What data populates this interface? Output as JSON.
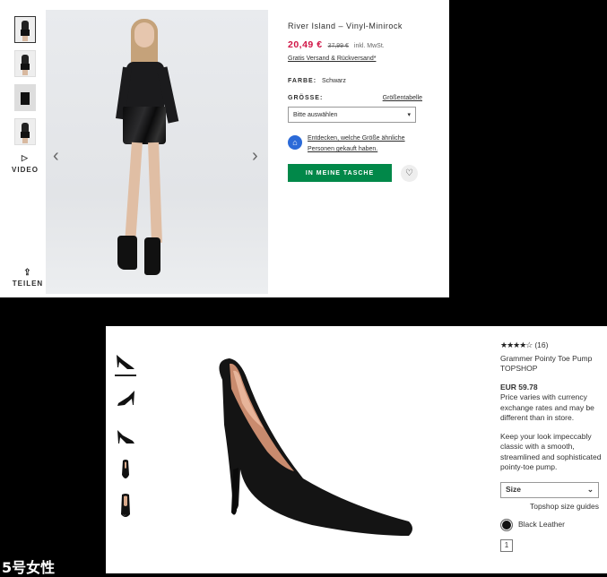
{
  "asos": {
    "video_label": "VIDEO",
    "share_label": "TEILEN",
    "product_title": "River Island – Vinyl-Minirock",
    "price_sale": "20,49 €",
    "price_old": "37,99 €",
    "price_note": "inkl. MwSt.",
    "shipping": "Gratis Versand & Rückversand*",
    "color_label": "FARBE:",
    "color_value": "Schwarz",
    "size_label": "GRÖSSE:",
    "size_guide": "Größentabelle",
    "size_placeholder": "Bitte auswählen",
    "fit_line1": "Entdecken, welche Größe ähnliche",
    "fit_line2": "Personen gekauft haben.",
    "cart_button": "IN MEINE TASCHE",
    "accent_sale": "#d01345",
    "accent_cart": "#018849"
  },
  "nordstrom": {
    "rating_count": "(16)",
    "rating_stars": 4,
    "product_title": "Grammer Pointy Toe Pump",
    "brand": "TOPSHOP",
    "price": "EUR 59.78",
    "price_note": "Price varies with currency exchange rates and may be different than in store.",
    "description": "Keep your look impeccably classic with a smooth, streamlined and sophisticated pointy-toe pump.",
    "size_label": "Size",
    "size_guide": "Topshop size guides",
    "color_value": "Black Leather",
    "quantity": "1"
  },
  "watermark": "5号女性"
}
